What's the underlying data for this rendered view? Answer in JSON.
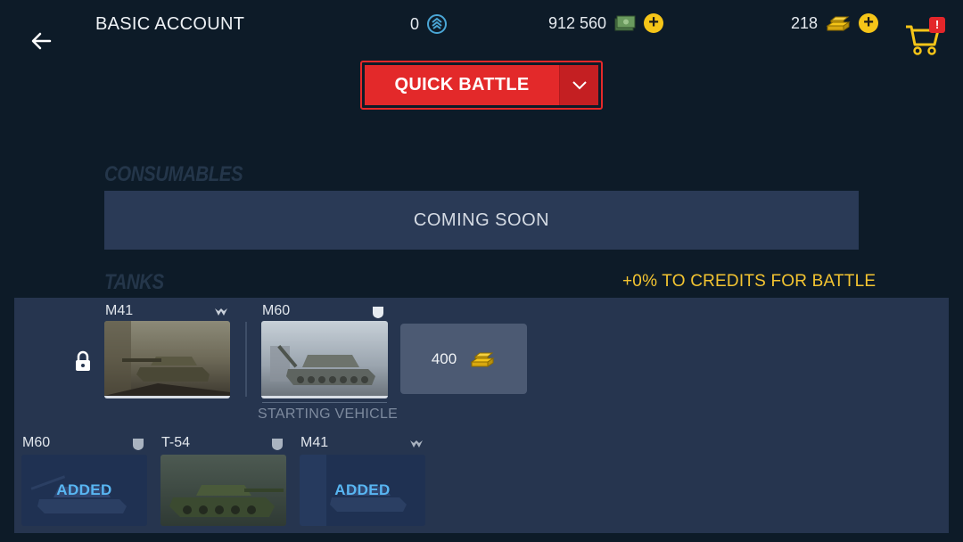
{
  "header": {
    "back_icon": "arrow-left-icon",
    "account_label": "BASIC ACCOUNT",
    "premium_value": "0",
    "credits_value": "912 560",
    "gold_value": "218",
    "cart_badge": "!"
  },
  "quick_battle": {
    "label": "QUICK BATTLE"
  },
  "consumables": {
    "title": "CONSUMABLES",
    "coming_soon": "COMING SOON"
  },
  "tanks": {
    "title": "TANKS",
    "bonus_text": "+0% TO CREDITS FOR BATTLE",
    "slots": [
      {
        "name": "M41",
        "class_icon": "light-tank-icon",
        "locked": true
      },
      {
        "name": "M60",
        "class_icon": "medium-tank-icon",
        "caption": "STARTING VEHICLE"
      }
    ],
    "buy_slot_price": "400",
    "garage": [
      {
        "name": "M60",
        "class_icon": "medium-tank-icon",
        "status": "ADDED"
      },
      {
        "name": "T-54",
        "class_icon": "medium-tank-icon",
        "status": ""
      },
      {
        "name": "M41",
        "class_icon": "light-tank-icon",
        "status": "ADDED"
      }
    ]
  },
  "colors": {
    "background": "#0d1b28",
    "panel": "#26354f",
    "accent_red": "#e3292a",
    "gold": "#f5c518",
    "added_blue": "#58b6f2"
  }
}
